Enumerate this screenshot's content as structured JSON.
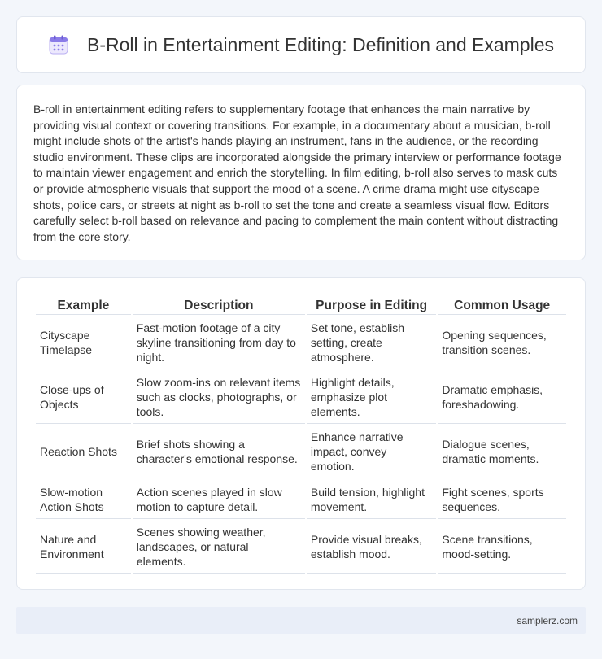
{
  "header": {
    "title": "B-Roll in Entertainment Editing: Definition and Examples",
    "icon": "calendar-icon",
    "icon_color": "#8a7be8"
  },
  "intro": {
    "text": "B-roll in entertainment editing refers to supplementary footage that enhances the main narrative by providing visual context or covering transitions. For example, in a documentary about a musician, b-roll might include shots of the artist's hands playing an instrument, fans in the audience, or the recording studio environment. These clips are incorporated alongside the primary interview or performance footage to maintain viewer engagement and enrich the storytelling. In film editing, b-roll also serves to mask cuts or provide atmospheric visuals that support the mood of a scene. A crime drama might use cityscape shots, police cars, or streets at night as b-roll to set the tone and create a seamless visual flow. Editors carefully select b-roll based on relevance and pacing to complement the main content without distracting from the core story."
  },
  "table": {
    "headers": [
      "Example",
      "Description",
      "Purpose in Editing",
      "Common Usage"
    ],
    "rows": [
      [
        "Cityscape Timelapse",
        "Fast-motion footage of a city skyline transitioning from day to night.",
        "Set tone, establish setting, create atmosphere.",
        "Opening sequences, transition scenes."
      ],
      [
        "Close-ups of Objects",
        "Slow zoom-ins on relevant items such as clocks, photographs, or tools.",
        "Highlight details, emphasize plot elements.",
        "Dramatic emphasis, foreshadowing."
      ],
      [
        "Reaction Shots",
        "Brief shots showing a character's emotional response.",
        "Enhance narrative impact, convey emotion.",
        "Dialogue scenes, dramatic moments."
      ],
      [
        "Slow-motion Action Shots",
        "Action scenes played in slow motion to capture detail.",
        "Build tension, highlight movement.",
        "Fight scenes, sports sequences."
      ],
      [
        "Nature and Environment",
        "Scenes showing weather, landscapes, or natural elements.",
        "Provide visual breaks, establish mood.",
        "Scene transitions, mood-setting."
      ]
    ]
  },
  "footer": {
    "site": "samplerz.com"
  }
}
